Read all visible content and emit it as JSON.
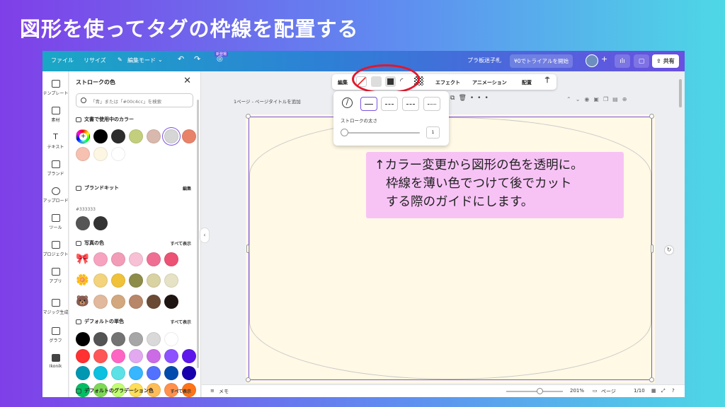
{
  "headline": "図形を使ってタグの枠線を配置する",
  "topbar": {
    "file": "ファイル",
    "resize": "リサイズ",
    "edit_mode": "編集モード",
    "new_badge": "新登場",
    "doc_title": "プラ板迷子札",
    "trial": "¥0でトライアルを開始",
    "share": "共有"
  },
  "rail": [
    {
      "label": "テンプレート",
      "icon": "template-icon"
    },
    {
      "label": "素材",
      "icon": "elements-icon"
    },
    {
      "label": "テキスト",
      "icon": "text-icon"
    },
    {
      "label": "ブランド",
      "icon": "brand-icon"
    },
    {
      "label": "アップロード",
      "icon": "upload-icon"
    },
    {
      "label": "ツール",
      "icon": "tools-icon"
    },
    {
      "label": "プロジェクト",
      "icon": "folder-icon"
    },
    {
      "label": "アプリ",
      "icon": "apps-icon"
    },
    {
      "label": "マジック生成",
      "icon": "magic-icon"
    },
    {
      "label": "グラフ",
      "icon": "chart-icon"
    },
    {
      "label": "Ikonik",
      "icon": "ikonik-icon"
    }
  ],
  "panel": {
    "title": "ストロークの色",
    "search_placeholder": "「青」または「#00c4cc」を検索",
    "doc_colors_title": "文書で使用中のカラー",
    "doc_colors": [
      "#000000",
      "#2d2d2d",
      "#c3cf7c",
      "#d9b9ad",
      "#d6d6d6",
      "#e8836a",
      "#f6c1b1",
      "#fdf6e3",
      "#ffffff"
    ],
    "brand_kit_title": "ブランドキット",
    "brand_kit_edit": "編集",
    "brand_hex": "#333333",
    "brand_colors": [
      "#555555",
      "#333333"
    ],
    "photo_colors_title": "写真の色",
    "show_all": "すべて表示",
    "photo_rows": [
      [
        "#f7a3c0",
        "#f29cb8",
        "#f7c0d4",
        "#ef6f93",
        "#ec5273"
      ],
      [
        "#f3d37c",
        "#f0c23a",
        "#8d8c49",
        "#d9d2a3",
        "#e6e2c6"
      ],
      [
        "#e2b99c",
        "#d3a87e",
        "#b88668",
        "#6b4a35",
        "#1e1410"
      ]
    ],
    "default_colors_title": "デフォルトの単色",
    "default_rows": [
      [
        "#000000",
        "#545454",
        "#737373",
        "#a6a6a6",
        "#d9d9d9",
        "#ffffff"
      ],
      [
        "#ff3131",
        "#ff5757",
        "#ff66c4",
        "#e2a9f1",
        "#cb6ce6",
        "#8c52ff",
        "#5e17eb"
      ],
      [
        "#0097b2",
        "#0cc0df",
        "#5ce1e6",
        "#38b6ff",
        "#5271ff",
        "#004aad",
        "#1800ad"
      ],
      [
        "#00bf63",
        "#7ed957",
        "#c1ff72",
        "#ffde59",
        "#ffbd59",
        "#ff914d",
        "#ff7417"
      ]
    ],
    "gradient_title": "デフォルトのグラデーション色"
  },
  "toolbar": {
    "edit": "編集",
    "effects": "エフェクト",
    "animation": "アニメーション",
    "position": "配置"
  },
  "page_header": "1ページ - ページタイトルを追加",
  "stroke_popup": {
    "label": "ストロークの太さ",
    "value": "1"
  },
  "callout": {
    "line1": "↑カラー変更から図形の色を透明に。",
    "line2": "枠線を薄い色でつけて後でカット",
    "line3": "する際のガイドにします。"
  },
  "bottombar": {
    "memo": "メモ",
    "zoom": "201%",
    "pages_label": "ページ",
    "page_count": "1/10"
  }
}
